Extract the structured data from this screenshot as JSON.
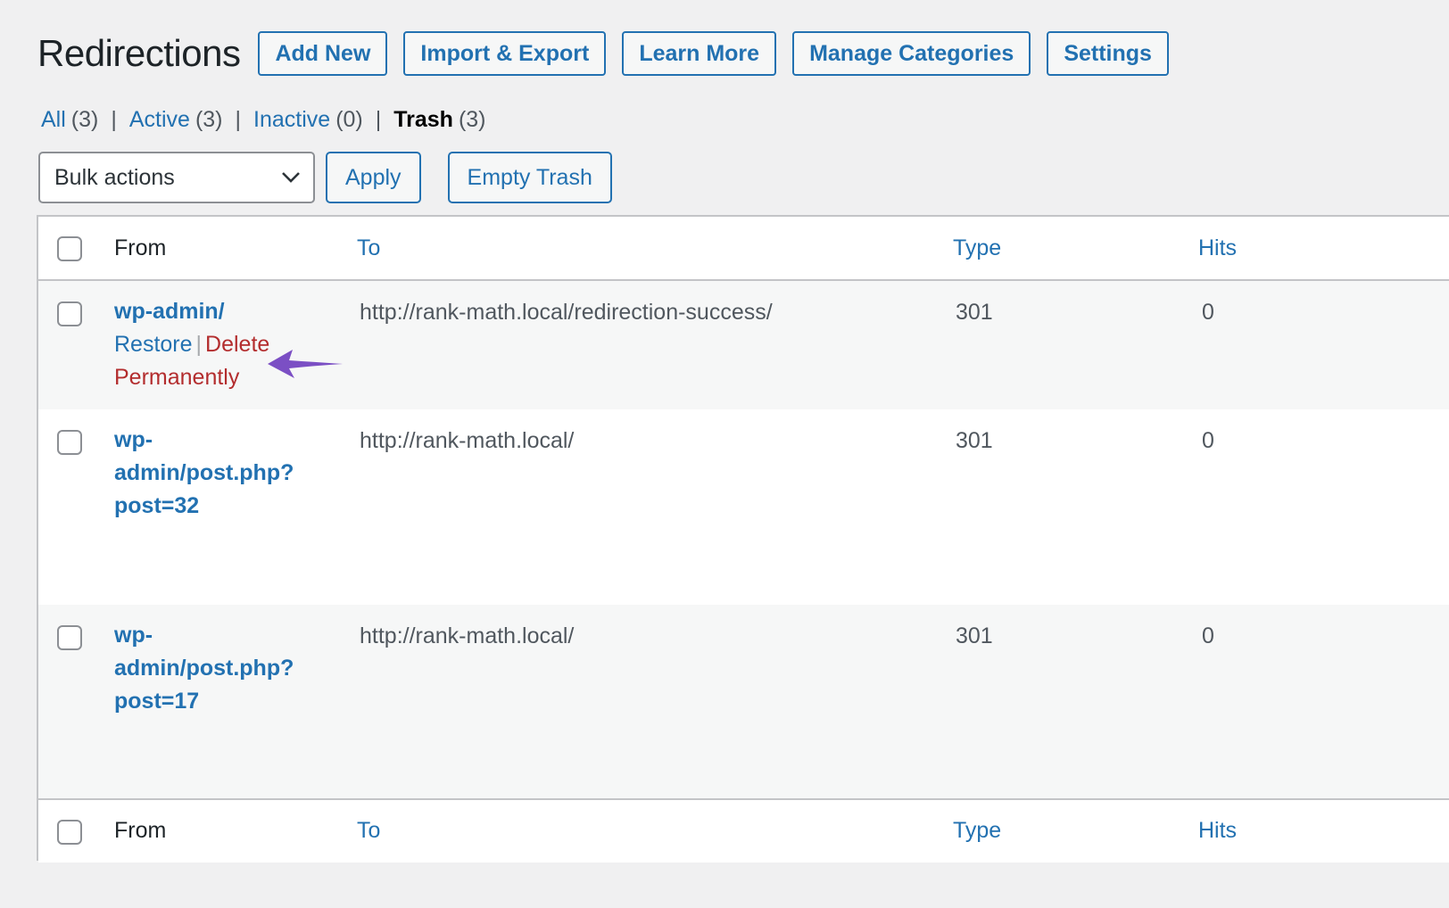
{
  "page": {
    "title": "Redirections",
    "header_buttons": [
      "Add New",
      "Import & Export",
      "Learn More",
      "Manage Categories",
      "Settings"
    ]
  },
  "filters": [
    {
      "label": "All",
      "count": "(3)",
      "current": false
    },
    {
      "label": "Active",
      "count": "(3)",
      "current": false
    },
    {
      "label": "Inactive",
      "count": "(0)",
      "current": false
    },
    {
      "label": "Trash",
      "count": "(3)",
      "current": true
    }
  ],
  "filter_separator": "|",
  "tablenav": {
    "bulk_select_value": "Bulk actions",
    "apply_label": "Apply",
    "empty_trash_label": "Empty Trash"
  },
  "table": {
    "columns": {
      "from": "From",
      "to": "To",
      "type": "Type",
      "hits": "Hits"
    },
    "rows": [
      {
        "from_lines": [
          "wp-admin/"
        ],
        "to": "http://rank-math.local/redirection-success/",
        "type": "301",
        "hits": "0",
        "actions": {
          "restore": "Restore",
          "separator": "|",
          "delete_line1": "Delete",
          "delete_line2": "Permanently"
        }
      },
      {
        "from_lines": [
          "wp-",
          "admin/post.php?",
          "post=32"
        ],
        "to": "http://rank-math.local/",
        "type": "301",
        "hits": "0"
      },
      {
        "from_lines": [
          "wp-",
          "admin/post.php?",
          "post=17"
        ],
        "to": "http://rank-math.local/",
        "type": "301",
        "hits": "0"
      }
    ]
  },
  "annotation": {
    "icon": "arrow-left-icon",
    "color": "#7b4fc4"
  },
  "colors": {
    "link": "#2271b1",
    "delete": "#b32d2e",
    "background": "#f0f0f1"
  }
}
